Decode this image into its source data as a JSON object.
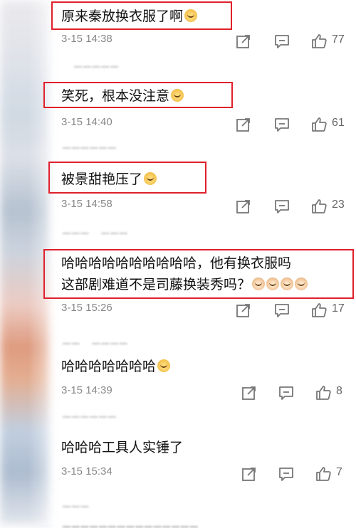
{
  "comments": [
    {
      "text": "原来秦放换衣服了啊",
      "emojis": [
        "smile"
      ],
      "time": "3-15 14:38",
      "likes": "77"
    },
    {
      "text": "笑死，根本没注意",
      "emojis": [
        "smile"
      ],
      "time": "3-15 14:40",
      "likes": "61"
    },
    {
      "text": "被景甜艳压了",
      "emojis": [
        "smile"
      ],
      "time": "3-15 14:58",
      "likes": "23"
    },
    {
      "text_line1": "哈哈哈哈哈哈哈哈哈哈，他有换衣服吗",
      "text_line2": "这部剧难道不是司藤换装秀吗？",
      "emojis": [
        "cat",
        "cat",
        "cat",
        "cat"
      ],
      "time": "3-15 15:26",
      "likes": "17"
    },
    {
      "text": "哈哈哈哈哈哈哈",
      "emojis": [
        "smile"
      ],
      "time": "3-15 14:39",
      "likes": "8"
    },
    {
      "text": "哈哈哈工具人实锤了",
      "emojis": [],
      "time": "3-15 15:34",
      "likes": "7"
    }
  ],
  "icons": {
    "share": "share-icon",
    "reply": "comment-icon",
    "like": "thumbs-up-icon"
  },
  "colors": {
    "highlight": "#e0202c",
    "timestamp": "#888888"
  }
}
